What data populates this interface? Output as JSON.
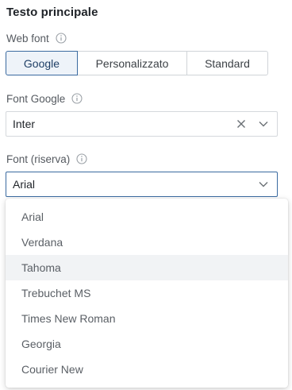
{
  "section": {
    "title": "Testo principale"
  },
  "web_font": {
    "label": "Web font",
    "options": [
      "Google",
      "Personalizzato",
      "Standard"
    ],
    "selected": "Google"
  },
  "google_font": {
    "label": "Font Google",
    "value": "Inter"
  },
  "fallback_font": {
    "label": "Font (riserva)",
    "value": "Arial",
    "options": [
      "Arial",
      "Verdana",
      "Tahoma",
      "Trebuchet MS",
      "Times New Roman",
      "Georgia",
      "Courier New"
    ],
    "highlighted": "Tahoma"
  },
  "icons": {
    "info": "info-circle-icon",
    "clear": "close-icon",
    "dropdown": "chevron-down-icon"
  },
  "colors": {
    "accent": "#3a6aa0",
    "active_bg": "#eef3f9",
    "hover_bg": "#f1f3f5"
  }
}
